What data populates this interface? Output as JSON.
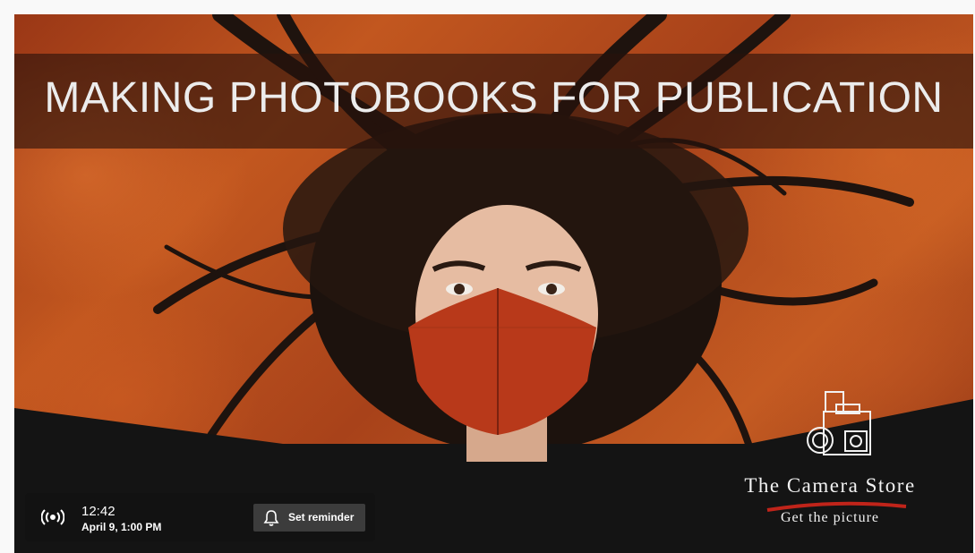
{
  "thumbnail": {
    "title": "MAKING PHOTOBOOKS FOR PUBLICATION",
    "logo": {
      "name": "The Camera Store",
      "tagline": "Get the picture",
      "icon": "camera-icon"
    },
    "colors": {
      "background": "#b04a1c",
      "title_band": "#2a120c",
      "mask": "#b8391a"
    }
  },
  "overlay": {
    "live_icon": "live-broadcast-icon",
    "time": "12:42",
    "date": "April 9, 1:00 PM",
    "reminder_icon": "bell-icon",
    "reminder_label": "Set reminder"
  }
}
